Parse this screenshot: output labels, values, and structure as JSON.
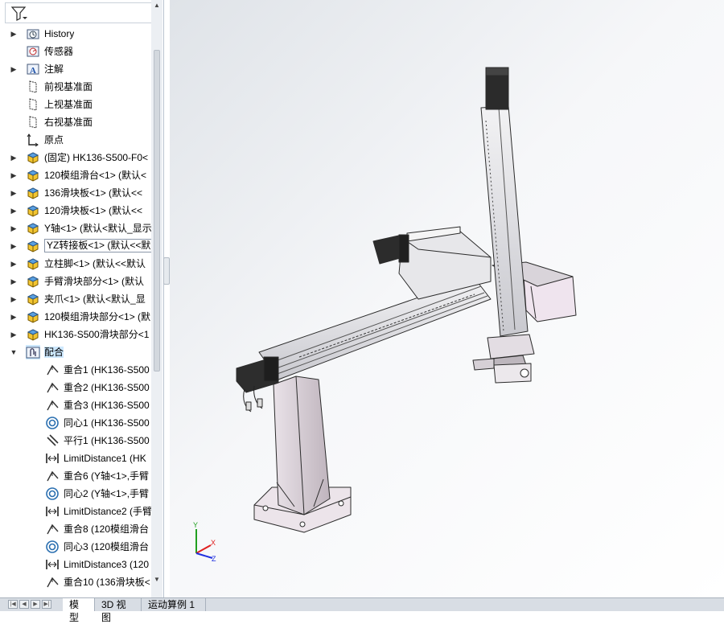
{
  "feature_tree": {
    "filter_icon": "filter-icon",
    "nodes": [
      {
        "label": "History",
        "icon": "history-folder-icon",
        "expander": "right"
      },
      {
        "label": "传感器",
        "icon": "sensor-icon",
        "expander": "none"
      },
      {
        "label": "注解",
        "icon": "annotation-icon",
        "expander": "right"
      },
      {
        "label": "前视基准面",
        "icon": "plane-icon",
        "expander": "none"
      },
      {
        "label": "上视基准面",
        "icon": "plane-icon",
        "expander": "none"
      },
      {
        "label": "右视基准面",
        "icon": "plane-icon",
        "expander": "none"
      },
      {
        "label": "原点",
        "icon": "origin-icon",
        "expander": "none"
      },
      {
        "label": "(固定) HK136-S500-F0<",
        "icon": "part-icon",
        "expander": "right"
      },
      {
        "label": "120模组滑台<1> (默认<",
        "icon": "part-icon",
        "expander": "right"
      },
      {
        "label": "136滑块板<1> (默认<<",
        "icon": "part-icon",
        "expander": "right"
      },
      {
        "label": "120滑块板<1> (默认<<",
        "icon": "part-icon",
        "expander": "right"
      },
      {
        "label": "Y轴<1> (默认<默认_显示",
        "icon": "part-icon",
        "expander": "right"
      },
      {
        "label": "YZ转接板<1> (默认<<默",
        "icon": "part-icon",
        "expander": "right",
        "selected": true
      },
      {
        "label": "立柱脚<1> (默认<<默认",
        "icon": "part-icon",
        "expander": "right"
      },
      {
        "label": "手臂滑块部分<1> (默认",
        "icon": "part-icon",
        "expander": "right"
      },
      {
        "label": "夹爪<1> (默认<默认_显",
        "icon": "part-icon",
        "expander": "right"
      },
      {
        "label": "120模组滑块部分<1> (默",
        "icon": "part-icon",
        "expander": "right"
      },
      {
        "label": "HK136-S500滑块部分<1",
        "icon": "part-icon",
        "expander": "right"
      },
      {
        "label": "配合",
        "icon": "mates-folder-icon",
        "expander": "down",
        "highlighted": true
      },
      {
        "label": "重合1 (HK136-S500",
        "icon": "coincident-mate-icon",
        "expander": "none",
        "indent": true
      },
      {
        "label": "重合2 (HK136-S500",
        "icon": "coincident-mate-icon",
        "expander": "none",
        "indent": true
      },
      {
        "label": "重合3 (HK136-S500",
        "icon": "coincident-mate-icon",
        "expander": "none",
        "indent": true
      },
      {
        "label": "同心1 (HK136-S500",
        "icon": "concentric-mate-icon",
        "expander": "none",
        "indent": true
      },
      {
        "label": "平行1 (HK136-S500",
        "icon": "parallel-mate-icon",
        "expander": "none",
        "indent": true
      },
      {
        "label": "LimitDistance1 (HK",
        "icon": "limit-distance-icon",
        "expander": "none",
        "indent": true
      },
      {
        "label": "重合6 (Y轴<1>,手臂",
        "icon": "coincident-mate-icon",
        "expander": "none",
        "indent": true
      },
      {
        "label": "同心2 (Y轴<1>,手臂",
        "icon": "concentric-mate-icon",
        "expander": "none",
        "indent": true
      },
      {
        "label": "LimitDistance2 (手臂",
        "icon": "limit-distance-icon",
        "expander": "none",
        "indent": true
      },
      {
        "label": "重合8 (120模组滑台",
        "icon": "coincident-mate-icon",
        "expander": "none",
        "indent": true
      },
      {
        "label": "同心3 (120模组滑台",
        "icon": "concentric-mate-icon",
        "expander": "none",
        "indent": true
      },
      {
        "label": "LimitDistance3 (120",
        "icon": "limit-distance-icon",
        "expander": "none",
        "indent": true
      },
      {
        "label": "重合10 (136滑块板<",
        "icon": "coincident-mate-icon",
        "expander": "none",
        "indent": true
      }
    ]
  },
  "triad": {
    "x_label": "X",
    "y_label": "Y",
    "z_label": "Z",
    "x_color": "#e02020",
    "y_color": "#20a020",
    "z_color": "#2030e0"
  },
  "bottom_tabs": [
    {
      "label": "模型",
      "active": true
    },
    {
      "label": "3D 视图",
      "active": false
    },
    {
      "label": "运动算例 1",
      "active": false
    }
  ],
  "colors": {
    "selection_highlight": "#cde8ff",
    "part_icon": "#f2c531",
    "frame_color": "#d8cbd6"
  }
}
